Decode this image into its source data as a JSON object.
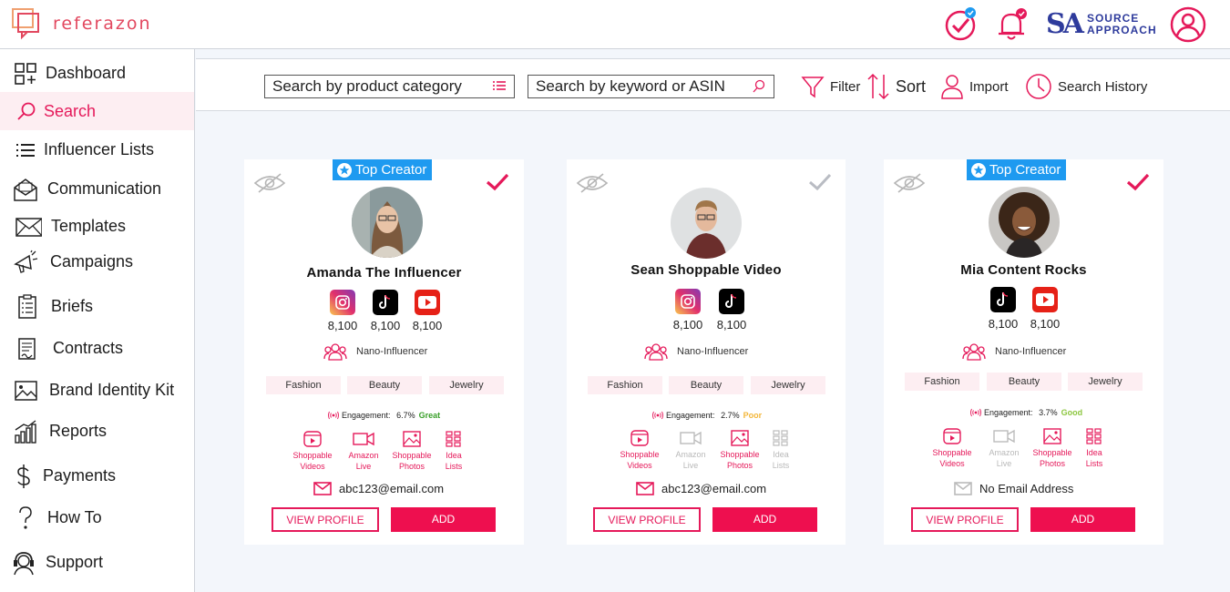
{
  "app": {
    "logo_text": "referazon",
    "brand_word1": "SOURCE",
    "brand_word2": "APPROACH"
  },
  "sidebar": {
    "items": [
      {
        "label": "Dashboard",
        "icon": "dashboard-icon"
      },
      {
        "label": "Search",
        "icon": "search-icon"
      },
      {
        "label": "Influencer Lists",
        "icon": "list-icon"
      },
      {
        "label": "Communication",
        "icon": "envelope-open-icon"
      },
      {
        "label": "Templates",
        "icon": "envelope-icon"
      },
      {
        "label": "Campaigns",
        "icon": "megaphone-icon"
      },
      {
        "label": "Briefs",
        "icon": "clipboard-icon"
      },
      {
        "label": "Contracts",
        "icon": "contract-icon"
      },
      {
        "label": "Brand Identity Kit",
        "icon": "image-icon"
      },
      {
        "label": "Reports",
        "icon": "bar-chart-icon"
      },
      {
        "label": "Payments",
        "icon": "dollar-icon"
      },
      {
        "label": "How To",
        "icon": "question-icon"
      },
      {
        "label": "Support",
        "icon": "headset-icon"
      }
    ],
    "active_index": 1
  },
  "toolbar": {
    "category_placeholder": "Search by product category",
    "keyword_placeholder": "Search by keyword or ASIN",
    "filter": "Filter",
    "sort": "Sort",
    "import": "Import",
    "history": "Search History"
  },
  "cards": [
    {
      "badge": "Top Creator",
      "selected": true,
      "name": "Amanda The Influencer",
      "socials": [
        {
          "icon": "instagram-icon",
          "count": "8,100"
        },
        {
          "icon": "tiktok-icon",
          "count": "8,100"
        },
        {
          "icon": "youtube-icon",
          "count": "8,100"
        }
      ],
      "tier": "Nano-Influencer",
      "tags": [
        "Fashion",
        "Beauty",
        "Jewelry"
      ],
      "engagement_label": "Engagement:",
      "engagement": "6.7%",
      "rating": "Great",
      "features": [
        {
          "line1": "Shoppable",
          "line2": "Videos",
          "on": true
        },
        {
          "line1": "Amazon",
          "line2": "Live",
          "on": true
        },
        {
          "line1": "Shoppable",
          "line2": "Photos",
          "on": true
        },
        {
          "line1": "Idea",
          "line2": "Lists",
          "on": true
        }
      ],
      "email": "abc123@email.com",
      "email_present": true,
      "view_label": "VIEW PROFILE",
      "add_label": "ADD"
    },
    {
      "badge": "",
      "selected": false,
      "name": "Sean Shoppable Video",
      "socials": [
        {
          "icon": "instagram-icon",
          "count": "8,100"
        },
        {
          "icon": "tiktok-icon",
          "count": "8,100"
        }
      ],
      "tier": "Nano-Influencer",
      "tags": [
        "Fashion",
        "Beauty",
        "Jewelry"
      ],
      "engagement_label": "Engagement:",
      "engagement": "2.7%",
      "rating": "Poor",
      "features": [
        {
          "line1": "Shoppable",
          "line2": "Videos",
          "on": true
        },
        {
          "line1": "Amazon",
          "line2": "Live",
          "on": false
        },
        {
          "line1": "Shoppable",
          "line2": "Photos",
          "on": true
        },
        {
          "line1": "Idea",
          "line2": "Lists",
          "on": false
        }
      ],
      "email": "abc123@email.com",
      "email_present": true,
      "view_label": "VIEW PROFILE",
      "add_label": "ADD"
    },
    {
      "badge": "Top Creator",
      "selected": true,
      "name": "Mia Content Rocks",
      "socials": [
        {
          "icon": "tiktok-icon",
          "count": "8,100"
        },
        {
          "icon": "youtube-icon",
          "count": "8,100"
        }
      ],
      "tier": "Nano-Influencer",
      "tags": [
        "Fashion",
        "Beauty",
        "Jewelry"
      ],
      "engagement_label": "Engagement:",
      "engagement": "3.7%",
      "rating": "Good",
      "features": [
        {
          "line1": "Shoppable",
          "line2": "Videos",
          "on": true
        },
        {
          "line1": "Amazon",
          "line2": "Live",
          "on": false
        },
        {
          "line1": "Shoppable",
          "line2": "Photos",
          "on": true
        },
        {
          "line1": "Idea",
          "line2": "Lists",
          "on": true
        }
      ],
      "email": "No Email Address",
      "email_present": false,
      "view_label": "VIEW PROFILE",
      "add_label": "ADD"
    }
  ],
  "colors": {
    "accent": "#e5195a",
    "badge": "#1e9af0",
    "great": "#3aa02a",
    "poor": "#f3b73b",
    "good": "#8cc63f"
  }
}
